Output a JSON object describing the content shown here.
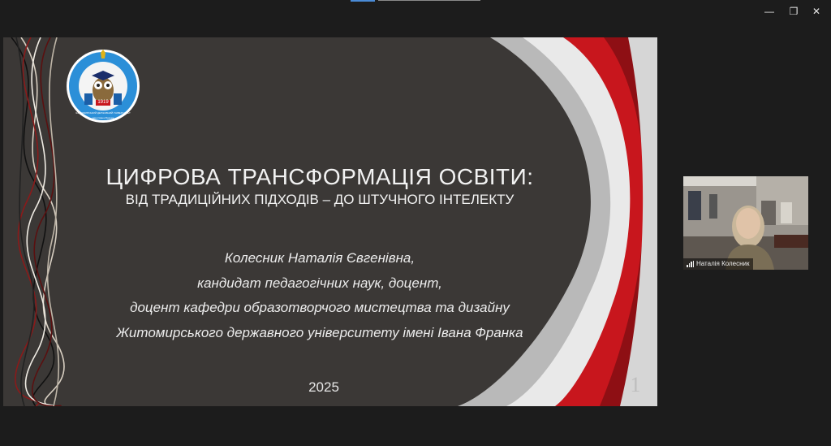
{
  "window": {
    "minimize_glyph": "—",
    "restore_glyph": "❐",
    "close_glyph": "✕"
  },
  "slide": {
    "title": "ЦИФРОВА ТРАНСФОРМАЦІЯ ОСВІТИ:",
    "subtitle": "ВІД ТРАДИЦІЙНИХ ПІДХОДІВ – ДО ШТУЧНОГО ІНТЕЛЕКТУ",
    "author_lines": [
      "Колесник Наталія Євгенівна,",
      "кандидат педагогічних наук, доцент,",
      "доцент кафедри образотворчого мистецтва та дизайну",
      "Житомирського державного університету імені Івана Франка"
    ],
    "year": "2025",
    "page_number": "1",
    "logo": {
      "icon": "university-owl-seal",
      "year_text": "1919",
      "ring_text_top": "ЖИТОМИРСЬКИЙ ДЕРЖАВНИЙ УНІВЕРСИТЕТ",
      "ring_text_bottom": "імені Івана Франка",
      "ring_color": "#2b8fd8",
      "accent_color": "#e0b318"
    }
  },
  "participant": {
    "name": "Наталія Колесник",
    "signal_icon": "signal-bars-icon"
  },
  "colors": {
    "background": "#1c1c1c",
    "slide_bg": "#3b3836",
    "slide_accent_red": "#c8161d",
    "slide_accent_grey": "#b9b9b9"
  }
}
